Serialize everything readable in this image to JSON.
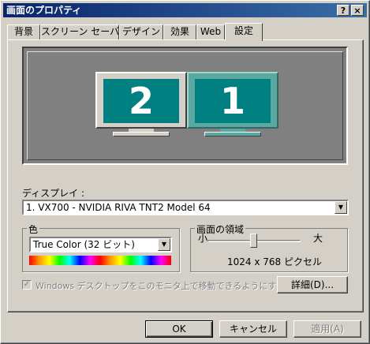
{
  "window": {
    "title": "画面のプロパティ",
    "help_button": "?",
    "close_button": "×"
  },
  "tabs": [
    {
      "label": "背景"
    },
    {
      "label": "スクリーン セーバー"
    },
    {
      "label": "デザイン"
    },
    {
      "label": "効果"
    },
    {
      "label": "Web"
    },
    {
      "label": "設定",
      "active": true
    }
  ],
  "preview": {
    "monitors": [
      {
        "number": "2",
        "selected": false
      },
      {
        "number": "1",
        "selected": true
      }
    ]
  },
  "display": {
    "label": "ディスプレイ :",
    "value": "1. VX700 - NVIDIA RIVA TNT2 Model 64"
  },
  "colors": {
    "group_label": "色",
    "value": "True Color (32 ビット)"
  },
  "screen_area": {
    "group_label": "画面の領域",
    "min_label": "小",
    "max_label": "大",
    "resolution": "1024 x 768 ピクセル",
    "slider_level": 0.47
  },
  "extend_desktop": {
    "label": "Windows デスクトップをこのモニタ上で移動できるようにする",
    "checked": true,
    "enabled": false
  },
  "buttons": {
    "advanced": "詳細(D)...",
    "ok": "OK",
    "cancel": "キャンセル",
    "apply": "適用(A)"
  }
}
